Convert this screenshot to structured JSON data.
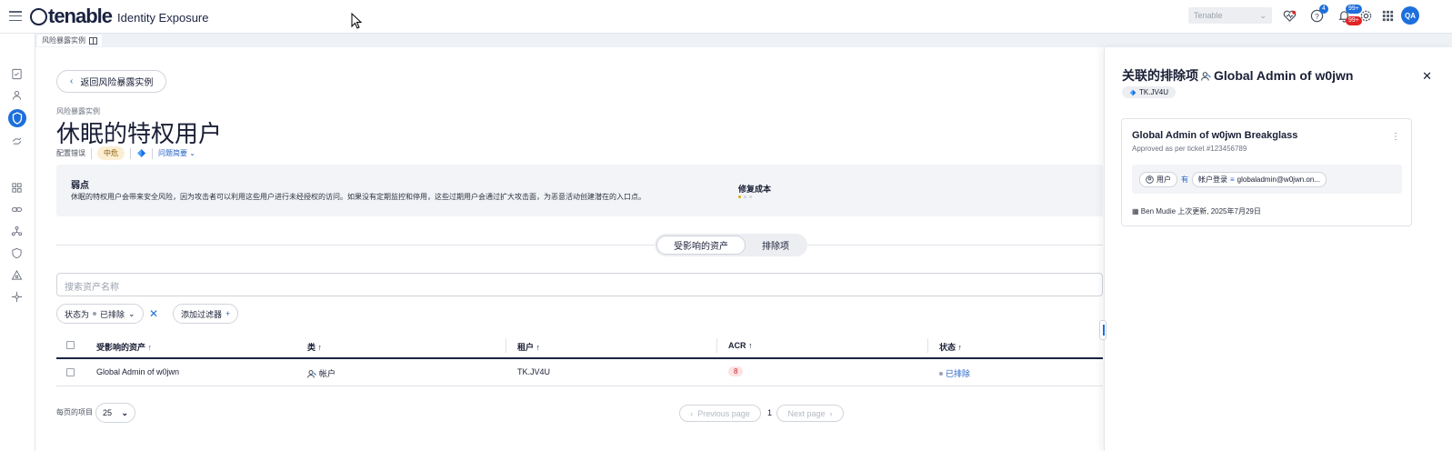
{
  "topbar": {
    "app_name": "tenable",
    "product": "Identity Exposure",
    "tenant": "Tenable",
    "help_badge": "4",
    "notif_badge_top": "99+",
    "notif_badge_bottom": "99+",
    "avatar": "QA",
    "icons": [
      "menu-icon",
      "heart-pulse-icon",
      "help-icon",
      "bell-icon",
      "gear-icon",
      "apps-grid-icon"
    ]
  },
  "breadcrumb": {
    "tab": "风险暴露实例"
  },
  "page": {
    "back_label": "返回风险暴露实例",
    "kicker": "风险暴露实例",
    "title": "休眠的特权用户",
    "category": "配置错误",
    "severity": "中危",
    "framework_link": "问题简要",
    "weakness_title": "弱点",
    "weakness_text": "休眠的特权用户会带来安全风险，因为攻击者可以利用这些用户进行未经授权的访问。如果没有定期监控和停用，这些过期用户会通过扩大攻击面，为恶意活动创建潜在的入口点。",
    "fix_cost_title": "修复成本",
    "fix_cost_level": 1
  },
  "tabs": {
    "affected": "受影响的资产",
    "exclusions": "排除项"
  },
  "search": {
    "placeholder": "搜索资产名称"
  },
  "filters": {
    "status_label": "状态为",
    "status_value": "已排除",
    "add_filter": "添加过滤器"
  },
  "table": {
    "headers": [
      "受影响的资产",
      "类",
      "租户",
      "ACR",
      "状态"
    ],
    "rows": [
      {
        "asset": "Global Admin of w0jwn",
        "class": "帐户",
        "tenant": "TK.JV4U",
        "acr": "8",
        "status": "已排除"
      }
    ]
  },
  "pagination": {
    "per_page_label": "每页的项目",
    "per_page": "25",
    "prev": "Previous page",
    "page": "1",
    "next": "Next page"
  },
  "drawer": {
    "title_prefix": "关联的排除项",
    "title_entity": "Global Admin of w0jwn",
    "tenant_tag": "TK.JV4U",
    "card": {
      "title": "Global Admin of w0jwn Breakglass",
      "subtitle": "Approved as per ticket #123456789",
      "rule_subject": "用户",
      "rule_op": "有",
      "rule_field": "帐户登录",
      "rule_value": "globaladmin@w0jwn.on...",
      "footer": "Ben Mudie 上次更新, 2025年7月29日"
    }
  }
}
